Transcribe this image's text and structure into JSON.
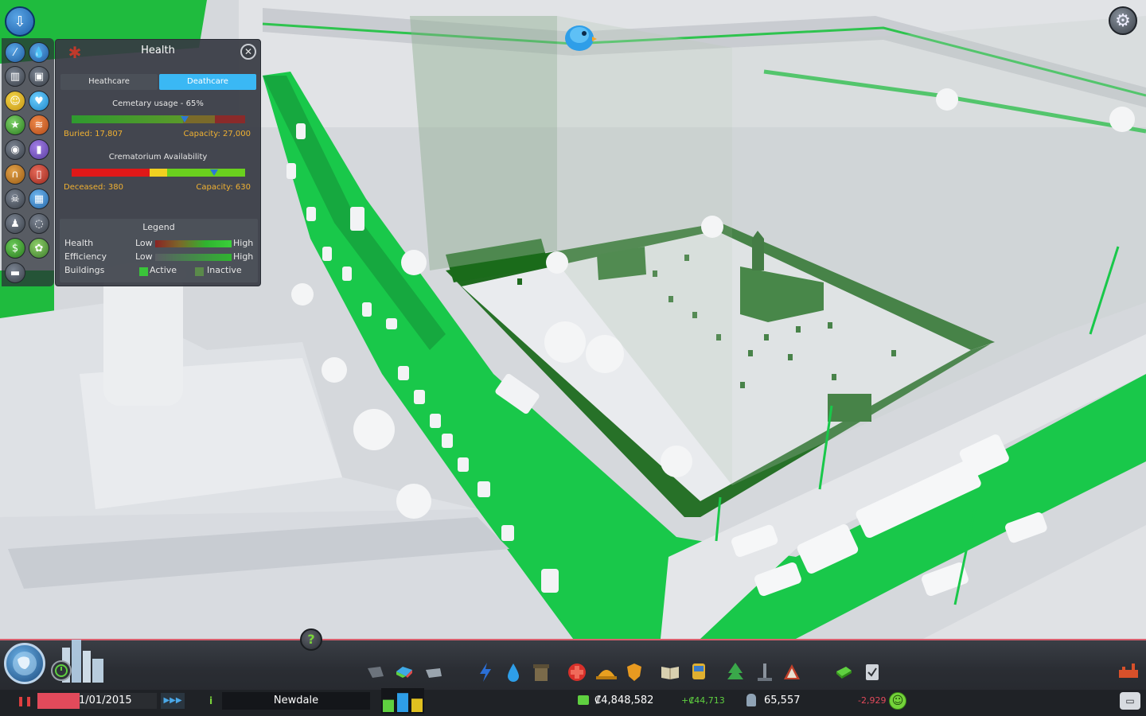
{
  "health_panel": {
    "title": "Health",
    "tabs": [
      {
        "label": "Heathcare",
        "active": false
      },
      {
        "label": "Deathcare",
        "active": true
      }
    ],
    "cemetery": {
      "label": "Cemetary usage - 65%",
      "usage_percent": 65,
      "buried": "Buried: 17,807",
      "capacity": "Capacity: 27,000"
    },
    "crematorium": {
      "label": "Crematorium Availability",
      "availability_percent": 82,
      "deceased": "Deceased: 380",
      "capacity": "Capacity: 630"
    },
    "legend": {
      "title": "Legend",
      "rows": [
        {
          "label": "Health",
          "low": "Low",
          "high": "High"
        },
        {
          "label": "Efficiency",
          "low": "Low",
          "high": "High"
        },
        {
          "label": "Buildings",
          "active": "Active",
          "inactive": "Inactive"
        }
      ]
    }
  },
  "info_views": [
    "electricity-icon",
    "water-icon",
    "garbage-icon",
    "landvalue-icon",
    "happiness-icon",
    "health-icon",
    "attractiveness-icon",
    "noise-icon",
    "police-icon",
    "fire-icon",
    "education-icon",
    "transport-icon",
    "crime-icon",
    "public-transport-icon",
    "population-icon",
    "wind-icon",
    "money-icon",
    "natural-resources-icon",
    "traffic-icon"
  ],
  "bottom_bar": {
    "date": "1/01/2015",
    "date_progress": 0.35,
    "city_name": "Newdale",
    "money": "₡4,848,582",
    "income": "+₡44,713",
    "population": "65,557",
    "population_change": "-2,929",
    "demand": {
      "residential": 0.55,
      "commercial": 0.85,
      "industrial": 0.6
    },
    "tools": [
      "roads-icon",
      "zoning-icon",
      "districts-icon",
      "electricity-tool-icon",
      "water-tool-icon",
      "garbage-tool-icon",
      "healthcare-tool-icon",
      "firedepartment-tool-icon",
      "police-tool-icon",
      "education-tool-icon",
      "public-transport-tool-icon",
      "beautification-tool-icon",
      "monuments-tool-icon",
      "wonders-tool-icon",
      "money-tool-icon",
      "policies-tool-icon"
    ]
  },
  "colors": {
    "overlay_green": "#19c84a",
    "dark_green": "#1e6b1e",
    "accent_blue": "#3ab8f4",
    "alert_red": "#e24a5b"
  }
}
